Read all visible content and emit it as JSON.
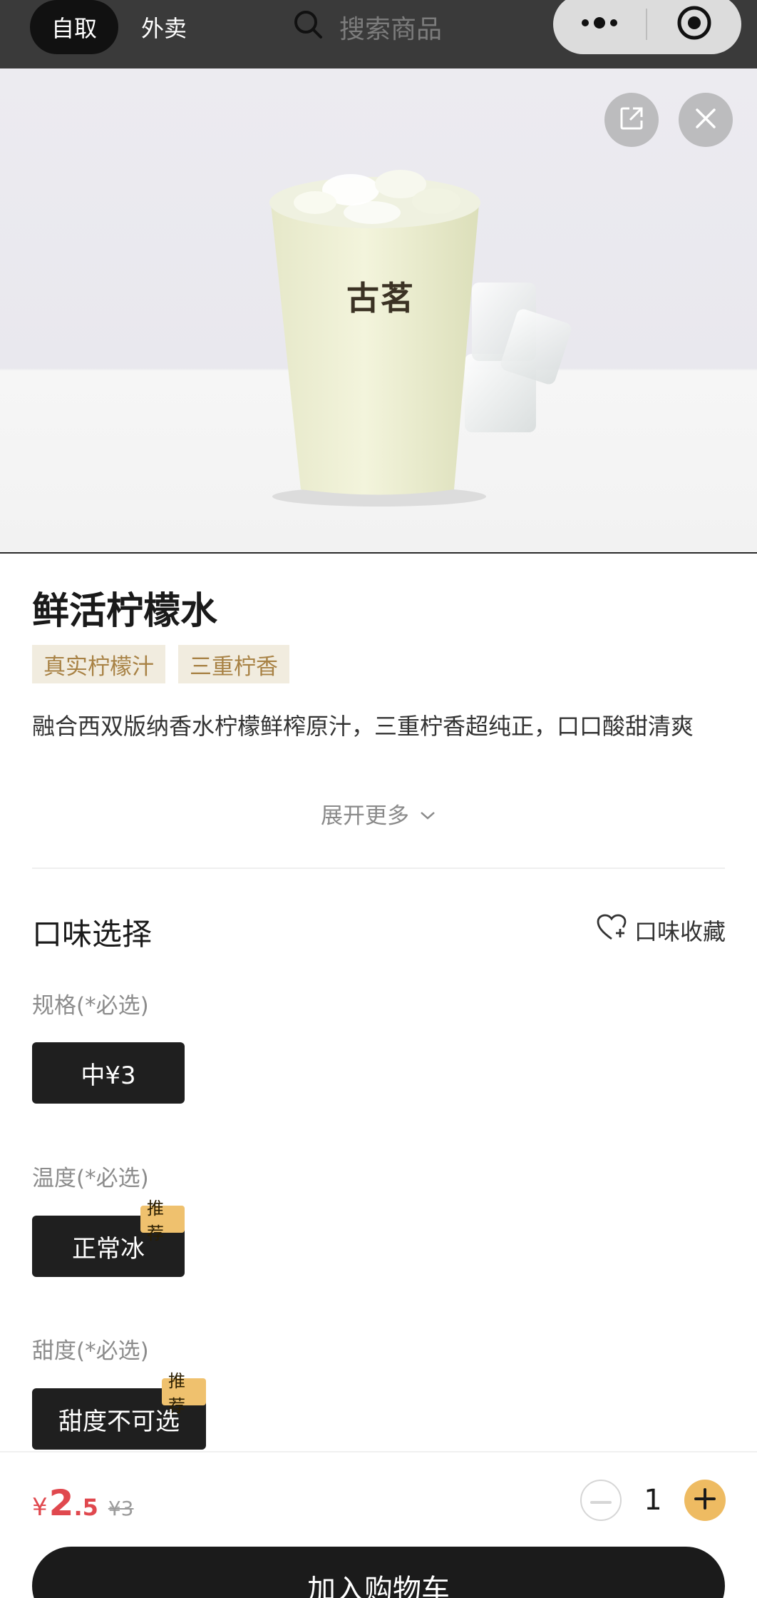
{
  "topbar": {
    "tab_pickup": "自取",
    "tab_delivery": "外卖",
    "search_placeholder": "搜索商品",
    "icons": [
      "search-icon",
      "more-icon",
      "target-icon"
    ]
  },
  "hero": {
    "product_text": "古茗",
    "icons": [
      "share-icon",
      "close-icon"
    ]
  },
  "product": {
    "name": "鲜活柠檬水",
    "tags": [
      "真实柠檬汁",
      "三重柠香"
    ],
    "description": "融合西双版纳香水柠檬鲜榨原汁，三重柠香超纯正，口口酸甜清爽",
    "expand_label": "展开更多"
  },
  "flavor": {
    "section_title": "口味选择",
    "favorite_label": "口味收藏",
    "options": [
      {
        "label": "规格(*必选)",
        "choice": "中¥3",
        "badge": ""
      },
      {
        "label": "温度(*必选)",
        "choice": "正常冰",
        "badge": "推荐"
      },
      {
        "label": "甜度(*必选)",
        "choice": "甜度不可选",
        "badge": "推荐"
      }
    ]
  },
  "bottom": {
    "currency": "¥",
    "price_int": "2",
    "price_dec": ".5",
    "original_price": "¥3",
    "quantity": "1",
    "add_to_cart": "加入购物车"
  },
  "colors": {
    "accent_price": "#e0484e",
    "accent_gold": "#eebb62",
    "tag_bg": "#f1ecdf",
    "tag_text": "#a88245",
    "dark": "#1f1f1f"
  }
}
